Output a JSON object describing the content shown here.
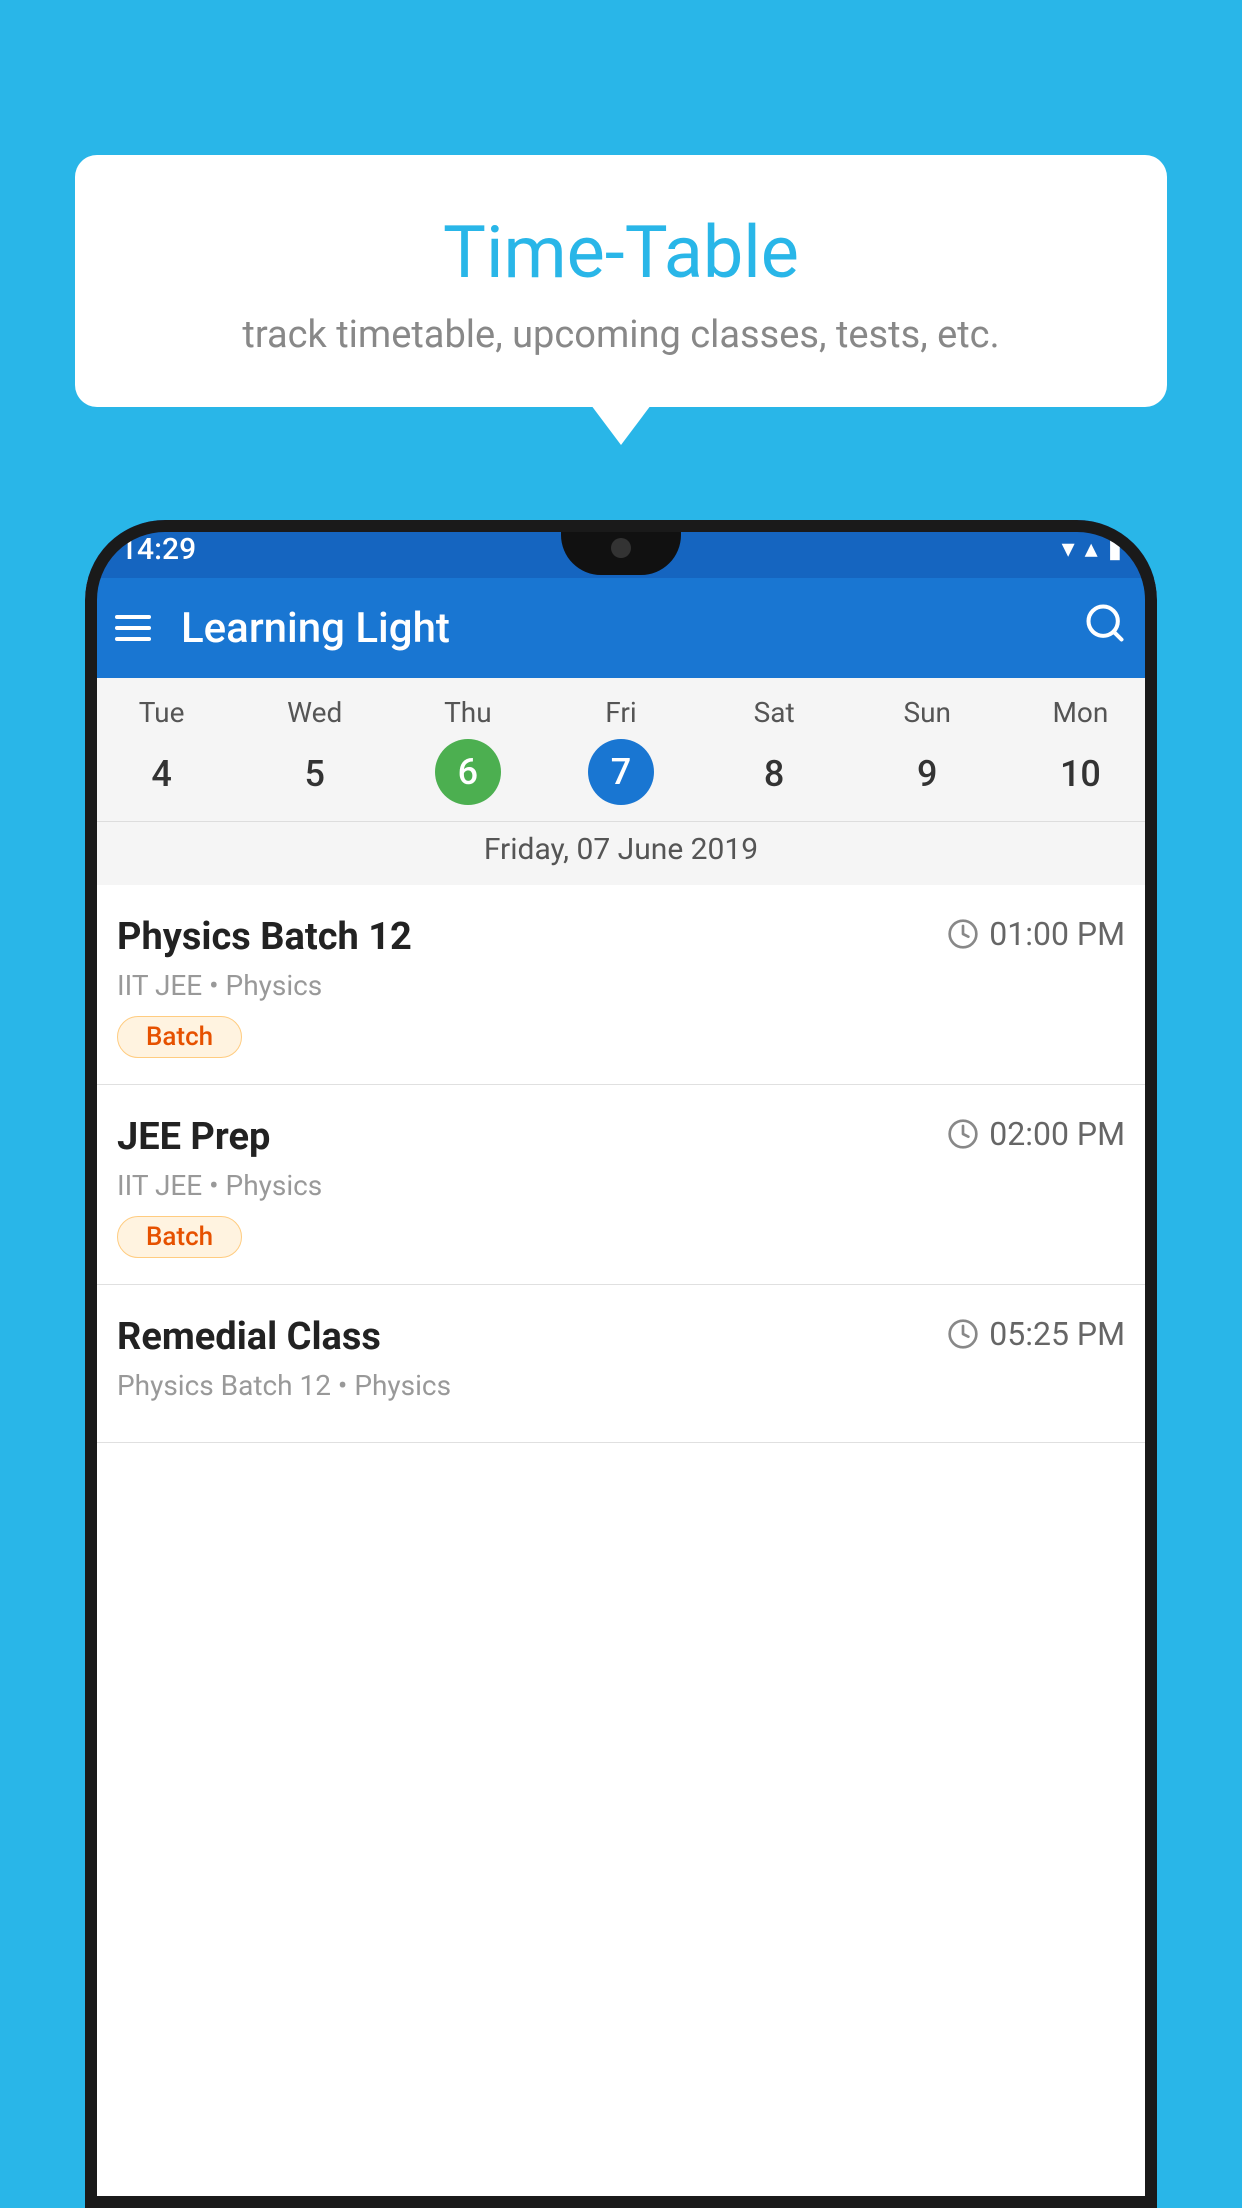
{
  "background_color": "#29B6E8",
  "bubble": {
    "title": "Time-Table",
    "subtitle": "track timetable, upcoming classes, tests, etc."
  },
  "phone": {
    "status_bar": {
      "time": "14:29",
      "wifi_icon": "▼",
      "signal_icon": "▲",
      "battery_icon": "▮"
    },
    "app_bar": {
      "title": "Learning Light",
      "menu_icon": "hamburger",
      "search_icon": "search"
    },
    "calendar": {
      "days": [
        "Tue",
        "Wed",
        "Thu",
        "Fri",
        "Sat",
        "Sun",
        "Mon"
      ],
      "dates": [
        "4",
        "5",
        "6",
        "7",
        "8",
        "9",
        "10"
      ],
      "today_index": 2,
      "selected_index": 3,
      "selected_date_label": "Friday, 07 June 2019"
    },
    "schedule": [
      {
        "title": "Physics Batch 12",
        "time": "01:00 PM",
        "subject_line": "IIT JEE • Physics",
        "tag": "Batch"
      },
      {
        "title": "JEE Prep",
        "time": "02:00 PM",
        "subject_line": "IIT JEE • Physics",
        "tag": "Batch"
      },
      {
        "title": "Remedial Class",
        "time": "05:25 PM",
        "subject_line": "Physics Batch 12 • Physics",
        "tag": null
      }
    ]
  }
}
